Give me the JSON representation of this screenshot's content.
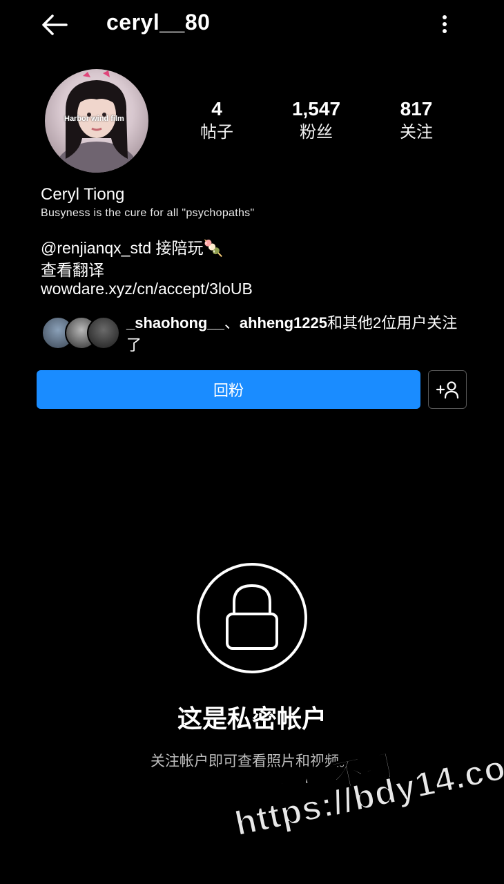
{
  "header": {
    "username": "ceryl__80",
    "back_icon": "back-arrow-icon",
    "more_icon": "more-vertical-icon"
  },
  "avatar": {
    "overlay_text": "Harbor wind film"
  },
  "stats": [
    {
      "value": "4",
      "label": "帖子"
    },
    {
      "value": "1,547",
      "label": "粉丝"
    },
    {
      "value": "817",
      "label": "关注"
    }
  ],
  "profile": {
    "full_name": "Ceryl Tiong",
    "tagline": "Busyness is the cure for all \"psychopaths\"",
    "bio_line1": "@renjianqx_std 接陪玩🍡",
    "translate": "查看翻译",
    "link": "wowdare.xyz/cn/accept/3loUB"
  },
  "mutual": {
    "user1": "_shaohong__",
    "sep": "、",
    "user2": "ahheng1225",
    "suffix": "和其他2位用户关注了"
  },
  "actions": {
    "follow_back": "回粉",
    "add_user_icon": "add-user-icon"
  },
  "private": {
    "icon": "lock-icon",
    "title": "这是私密帐户",
    "subtitle": "关注帐户即可查看照片和视频。"
  },
  "watermark": {
    "line1": "黑料不打烊",
    "line2": "https://bdy14.co"
  },
  "colors": {
    "background": "#000000",
    "accent": "#1a8cff",
    "text": "#ffffff",
    "muted": "#bdbdbd"
  }
}
